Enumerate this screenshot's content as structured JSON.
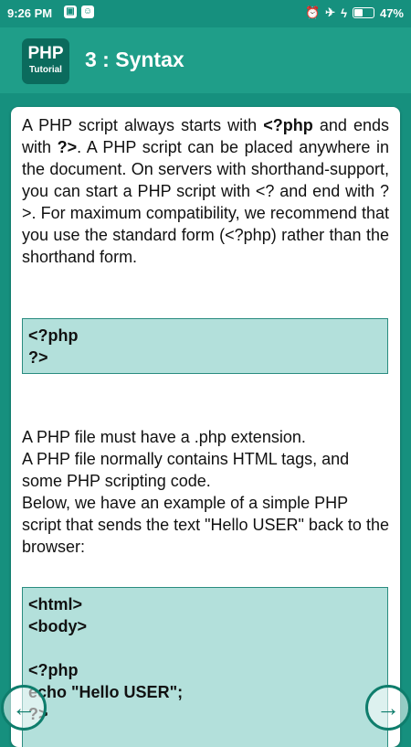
{
  "status": {
    "time": "9:26 PM",
    "battery": "47%",
    "battery_level": 0.47
  },
  "appbar": {
    "logo_top": "PHP",
    "logo_bottom": "Tutorial",
    "title": "3 : Syntax"
  },
  "intro": {
    "part1": "A PHP script always starts with ",
    "b1": "<?php",
    "part2": " and ends with ",
    "b2": "?>",
    "part3": ". A PHP script can be placed anywhere in the document. On servers with shorthand-support, you can start a PHP script with <? and end with ?>. For maximum compatibility, we recommend that you use the standard form (<?php) rather than the shorthand form."
  },
  "code1": "<?php\n?>",
  "para2": {
    "line1": "A PHP file must have a .php extension.",
    "line2": "A PHP file normally contains HTML tags, and some PHP scripting code.",
    "line3": "Below, we have an example of a simple PHP script that sends the text \"Hello USER\" back to the browser:"
  },
  "code2": "<html>\n<body>\n\n<?php\necho \"Hello USER\";\n?>",
  "nav": {
    "prev_glyph": "←",
    "next_glyph": "→"
  }
}
